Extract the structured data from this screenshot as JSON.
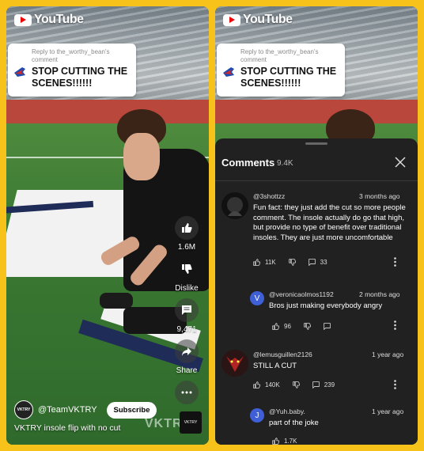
{
  "app": {
    "logo_text": "YouTube"
  },
  "reply_card": {
    "meta": "Reply to the_worthy_bean's comment",
    "text": "STOP CUTTING THE SCENES!!!!!!"
  },
  "actions": {
    "like_count": "1.6M",
    "dislike_label": "Dislike",
    "comment_count": "9,471",
    "share_label": "Share"
  },
  "video": {
    "channel": "@TeamVKTRY",
    "channel_avatar_text": "VKTRY",
    "subscribe_label": "Subscribe",
    "title": "VKTRY insole flip with no cut",
    "watermark": "VKTR",
    "thumb_text": "VKTRY"
  },
  "comments": {
    "title": "Comments",
    "count": "9.4K",
    "items": [
      {
        "user": "@3shottzz",
        "time": "3 months ago",
        "text": "Fun fact: they just add the cut so more people comment. The insole actually do go that high, but provide no type of benefit over traditional insoles. They are just more uncomfortable",
        "likes": "11K",
        "replies": "33"
      },
      {
        "user": "@veronicaolmos1192",
        "time": "2 months ago",
        "avatar_letter": "V",
        "text": "Bros just making everybody angry",
        "likes": "96"
      },
      {
        "user": "@lemusguillen2126",
        "time": "1 year ago",
        "text": "STILL A CUT",
        "likes": "140K",
        "replies": "239"
      },
      {
        "user": "@Yuh.baby.",
        "time": "1 year ago",
        "avatar_letter": "J",
        "text": "part of the joke",
        "likes": "1.7K"
      }
    ]
  },
  "colors": {
    "background": "#f7c21a",
    "sheet": "#212121",
    "avatar_blue": "#3f5fd6"
  }
}
